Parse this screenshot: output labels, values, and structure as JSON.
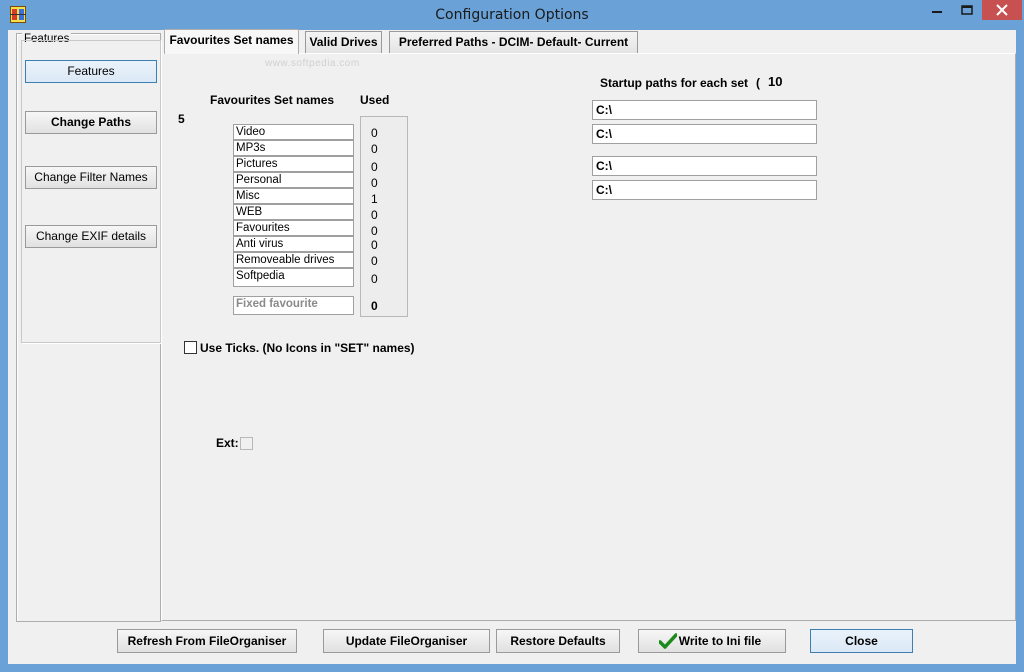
{
  "window": {
    "title": "Configuration Options",
    "controls": {
      "minimize": "–",
      "maximize": "□",
      "close": "✕"
    }
  },
  "features_panel": {
    "legend": "Features",
    "buttons": [
      "Features",
      "Change Paths",
      "Change Filter Names",
      "Change EXIF details"
    ]
  },
  "tabs": [
    {
      "label": "Favourites Set names",
      "active": true
    },
    {
      "label": "Valid Drives",
      "active": false
    },
    {
      "label": "Preferred Paths - DCIM- Default- Current",
      "active": false
    }
  ],
  "favourites": {
    "count": "5",
    "header_names": "Favourites Set names",
    "header_used": "Used",
    "items": [
      {
        "name": "Video",
        "used": "0"
      },
      {
        "name": "MP3s",
        "used": "0"
      },
      {
        "name": "Pictures",
        "used": "0"
      },
      {
        "name": "Personal",
        "used": "0"
      },
      {
        "name": "Misc",
        "used": "1"
      },
      {
        "name": "WEB",
        "used": "0"
      },
      {
        "name": "Favourites",
        "used": "0"
      },
      {
        "name": "Anti virus",
        "used": "0"
      },
      {
        "name": "Removeable drives",
        "used": "0"
      },
      {
        "name": "Softpedia",
        "used": "0"
      }
    ],
    "fixed": {
      "name": "Fixed favourite",
      "used": "0"
    }
  },
  "startup": {
    "label": "Startup paths for each set",
    "paren": "(",
    "count": "10",
    "paths": [
      "C:\\",
      "C:\\",
      "C:\\",
      "C:\\"
    ]
  },
  "options": {
    "use_ticks_label": "Use Ticks. (No Icons in \"SET\" names)",
    "ext_label": "Ext:"
  },
  "watermark": "www.softpedia.com",
  "bottom_buttons": {
    "refresh": "Refresh From FileOrganiser",
    "update": "Update FileOrganiser",
    "restore": "Restore Defaults",
    "write": "Write to Ini file",
    "close": "Close"
  },
  "colors": {
    "titlebar": "#6aa2d8",
    "close_button": "#c75050",
    "client": "#f0f0f0",
    "check_green": "#1a8a1a"
  }
}
